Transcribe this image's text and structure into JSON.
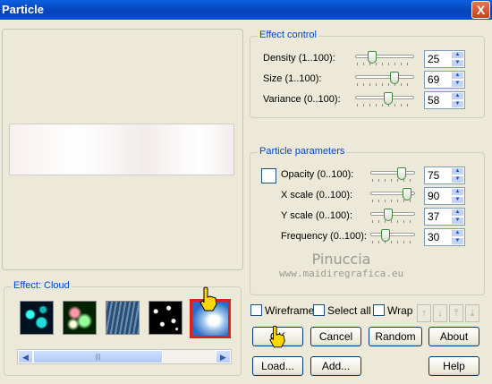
{
  "window": {
    "title": "Particle",
    "close_label": "X"
  },
  "effect_control": {
    "title": "Effect control",
    "rows": [
      {
        "label": "Density (1..100):",
        "value": "25",
        "level": 0.25
      },
      {
        "label": "Size (1..100):",
        "value": "69",
        "level": 0.69
      },
      {
        "label": "Variance (0..100):",
        "value": "58",
        "level": 0.58
      }
    ]
  },
  "particle_parameters": {
    "title": "Particle parameters",
    "rows": [
      {
        "label": "Opacity (0..100):",
        "value": "75",
        "level": 0.75
      },
      {
        "label": "X scale (0..100):",
        "value": "90",
        "level": 0.9
      },
      {
        "label": "Y scale (0..100):",
        "value": "37",
        "level": 0.37
      },
      {
        "label": "Frequency (0..100):",
        "value": "30",
        "level": 0.3
      }
    ]
  },
  "effect": {
    "title": "Effect: Cloud",
    "thumbnails": [
      "bubbles",
      "glow-orbs",
      "rain",
      "stars",
      "cloud"
    ],
    "selected": "cloud"
  },
  "watermark": {
    "line1": "Pinuccia",
    "line2": "www.maidiregrafica.eu"
  },
  "options": {
    "wireframe": "Wireframe",
    "select_all": "Select all",
    "wrap": "Wrap"
  },
  "buttons": {
    "ok": "OK",
    "cancel": "Cancel",
    "random": "Random",
    "about": "About",
    "load": "Load...",
    "add": "Add...",
    "help": "Help"
  },
  "colors": {
    "accent": "#0046d5",
    "selected_border": "#e0201b"
  }
}
